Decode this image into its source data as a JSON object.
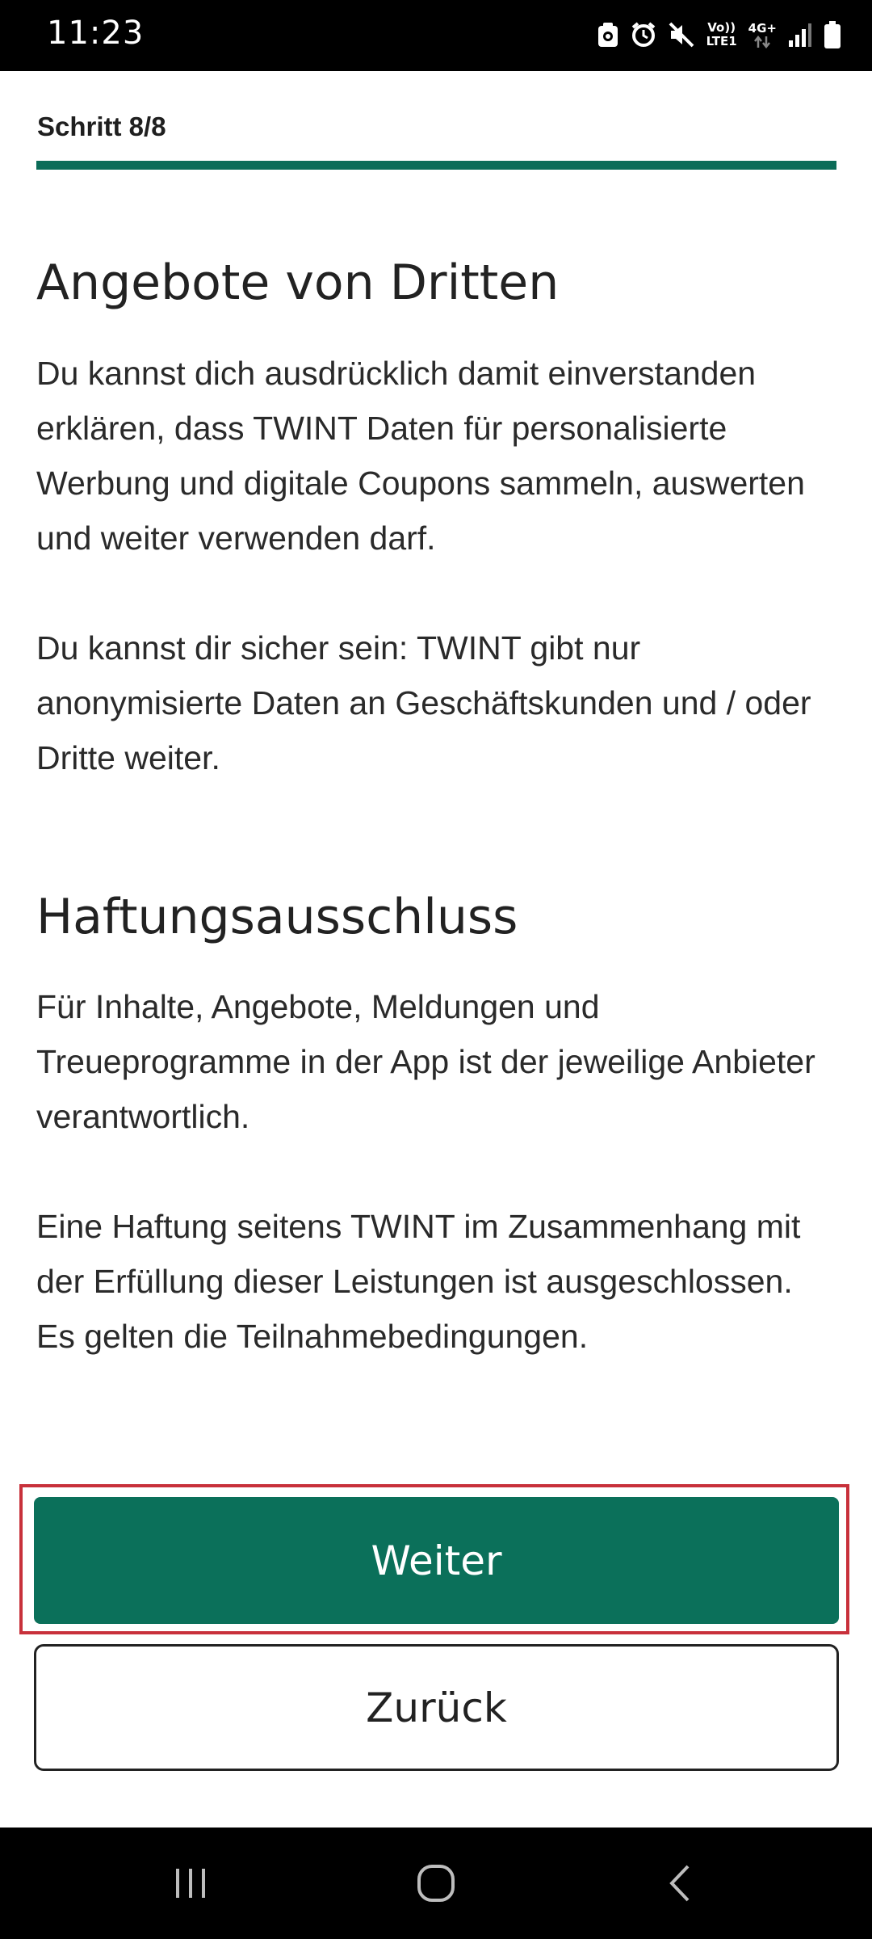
{
  "status_bar": {
    "time": "11:23",
    "network_top": "4G+",
    "volte_top": "Vo))",
    "volte_bottom": "LTE1",
    "icons": [
      "screenshot-icon",
      "alarm-icon",
      "mute-icon",
      "volte-icon",
      "network-4g-icon",
      "signal-icon",
      "battery-icon"
    ]
  },
  "header": {
    "step": "Schritt 8/8",
    "progress": 1.0
  },
  "sections": {
    "third_party": {
      "title": "Angebote von Dritten",
      "p1": "Du kannst dich ausdrücklich damit einverstanden erklären, dass TWINT Daten für personalisierte Werbung und digitale Coupons sammeln, auswerten und weiter verwenden darf.",
      "p2": "Du kannst dir sicher sein: TWINT gibt nur anonymisierte Daten an Geschäftskunden und / oder Dritte weiter."
    },
    "disclaimer": {
      "title": "Haftungsausschluss",
      "p1": "Für Inhalte, Angebote, Meldungen und Treueprogramme in der App ist der jeweilige Anbieter verantwortlich.",
      "p2": "Eine Haftung seitens TWINT im Zusammenhang mit der Erfüllung dieser Leistungen ist ausgeschlossen.",
      "p3": "Es gelten die Teilnahmebedingungen."
    }
  },
  "buttons": {
    "next": "Weiter",
    "back": "Zurück"
  },
  "nav_bar": {
    "icons": [
      "recent-apps-icon",
      "home-icon",
      "back-icon"
    ]
  },
  "colors": {
    "accent": "#0b705a",
    "highlight": "#c8313b"
  }
}
